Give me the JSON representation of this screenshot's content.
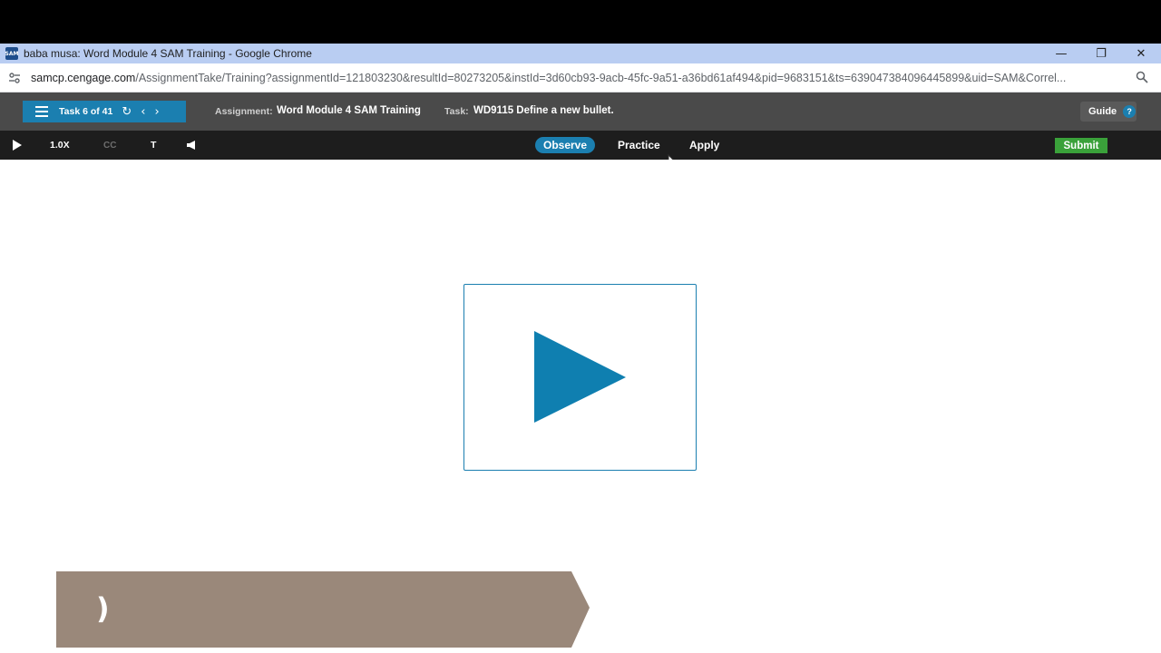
{
  "window": {
    "title": "baba musa: Word Module 4 SAM Training - Google Chrome",
    "app_icon_text": "SAM",
    "controls": {
      "minimize": "—",
      "restore": "❐",
      "close": "✕"
    }
  },
  "browser": {
    "url_host": "samcp.cengage.com",
    "url_path": "/AssignmentTake/Training?assignmentId=121803230&resultId=80273205&instId=3d60cb93-9acb-45fc-9a51-a36bd61af494&pid=9683151&ts=639047384096445899&uid=SAM&Correl..."
  },
  "sam_header": {
    "task_counter": "Task 6 of 41",
    "assignment_label": "Assignment:",
    "assignment_value": "Word Module 4 SAM Training",
    "task_label": "Task:",
    "task_value": "WD9115 Define a new bullet.",
    "guide_label": "Guide",
    "help_symbol": "?"
  },
  "player": {
    "speed": "1.0X",
    "cc_label": "CC",
    "text_toggle": "T",
    "modes": [
      "Observe",
      "Practice",
      "Apply"
    ],
    "active_mode": "Observe",
    "submit_label": "Submit"
  },
  "content": {
    "banner_text": ")"
  },
  "colors": {
    "accent": "#1b7fb0",
    "submit": "#3aa13a",
    "banner": "#9a887a",
    "header_bg": "#4a4a4a",
    "player_bg": "#1d1d1d"
  }
}
